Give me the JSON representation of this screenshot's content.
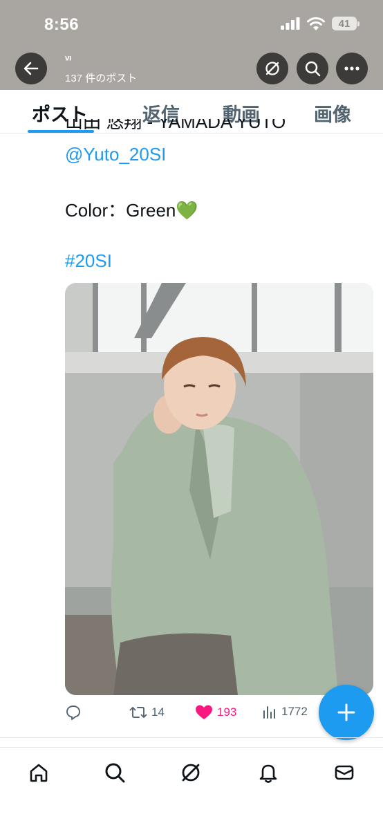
{
  "status_bar": {
    "time": "8:56",
    "battery": "41"
  },
  "header": {
    "name": "ᵛᶦ",
    "post_count": "137 件のポスト"
  },
  "tabs": [
    {
      "label": "ポスト",
      "active": true
    },
    {
      "label": "返信",
      "active": false
    },
    {
      "label": "動画",
      "active": false
    },
    {
      "label": "画像",
      "active": false
    }
  ],
  "post": {
    "clipped_line": "山田 悠翔 - YAMADA YUTO",
    "mention": "@Yuto_20SI",
    "color_line": "Color：Green💚",
    "hashtag": "#20SI",
    "reply_count": "",
    "retweet_count": "14",
    "like_count": "193",
    "view_count": "1772",
    "liked": true
  },
  "colors": {
    "accent": "#1d9bf0",
    "like": "#f91880",
    "text": "#0f1419",
    "secondary": "#536471"
  },
  "bottom_nav": [
    "home-icon",
    "search-icon",
    "grok-icon",
    "notifications-icon",
    "messages-icon"
  ]
}
